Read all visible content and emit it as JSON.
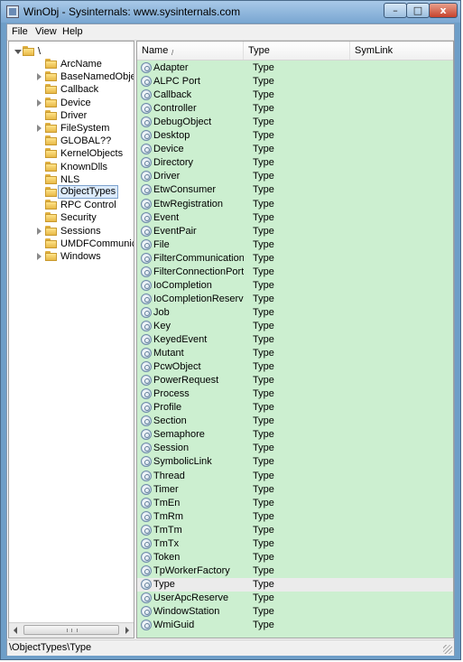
{
  "window": {
    "title": "WinObj - Sysinternals: www.sysinternals.com",
    "controls": {
      "minimize": "–",
      "maximize": "□",
      "close": "x"
    }
  },
  "menu": [
    "File",
    "View",
    "Help"
  ],
  "tree": {
    "root": "\\",
    "children": [
      {
        "label": "ArcName",
        "expandable": false
      },
      {
        "label": "BaseNamedObjects",
        "expandable": true
      },
      {
        "label": "Callback",
        "expandable": false
      },
      {
        "label": "Device",
        "expandable": true
      },
      {
        "label": "Driver",
        "expandable": false
      },
      {
        "label": "FileSystem",
        "expandable": true
      },
      {
        "label": "GLOBAL??",
        "expandable": false
      },
      {
        "label": "KernelObjects",
        "expandable": false
      },
      {
        "label": "KnownDlls",
        "expandable": false
      },
      {
        "label": "NLS",
        "expandable": false
      },
      {
        "label": "ObjectTypes",
        "expandable": false,
        "selected": true
      },
      {
        "label": "RPC Control",
        "expandable": false
      },
      {
        "label": "Security",
        "expandable": false
      },
      {
        "label": "Sessions",
        "expandable": true
      },
      {
        "label": "UMDFCommunicationPorts",
        "expandable": false
      },
      {
        "label": "Windows",
        "expandable": true
      }
    ]
  },
  "list": {
    "columns": [
      "Name",
      "Type",
      "SymLink"
    ],
    "sort_indicator": "/",
    "rows": [
      {
        "name": "Adapter",
        "type": "Type"
      },
      {
        "name": "ALPC Port",
        "type": "Type"
      },
      {
        "name": "Callback",
        "type": "Type"
      },
      {
        "name": "Controller",
        "type": "Type"
      },
      {
        "name": "DebugObject",
        "type": "Type"
      },
      {
        "name": "Desktop",
        "type": "Type"
      },
      {
        "name": "Device",
        "type": "Type"
      },
      {
        "name": "Directory",
        "type": "Type"
      },
      {
        "name": "Driver",
        "type": "Type"
      },
      {
        "name": "EtwConsumer",
        "type": "Type"
      },
      {
        "name": "EtwRegistration",
        "type": "Type"
      },
      {
        "name": "Event",
        "type": "Type"
      },
      {
        "name": "EventPair",
        "type": "Type"
      },
      {
        "name": "File",
        "type": "Type"
      },
      {
        "name": "FilterCommunication...",
        "type": "Type"
      },
      {
        "name": "FilterConnectionPort",
        "type": "Type"
      },
      {
        "name": "IoCompletion",
        "type": "Type"
      },
      {
        "name": "IoCompletionReserve",
        "type": "Type"
      },
      {
        "name": "Job",
        "type": "Type"
      },
      {
        "name": "Key",
        "type": "Type"
      },
      {
        "name": "KeyedEvent",
        "type": "Type"
      },
      {
        "name": "Mutant",
        "type": "Type"
      },
      {
        "name": "PcwObject",
        "type": "Type"
      },
      {
        "name": "PowerRequest",
        "type": "Type"
      },
      {
        "name": "Process",
        "type": "Type"
      },
      {
        "name": "Profile",
        "type": "Type"
      },
      {
        "name": "Section",
        "type": "Type"
      },
      {
        "name": "Semaphore",
        "type": "Type"
      },
      {
        "name": "Session",
        "type": "Type"
      },
      {
        "name": "SymbolicLink",
        "type": "Type"
      },
      {
        "name": "Thread",
        "type": "Type"
      },
      {
        "name": "Timer",
        "type": "Type"
      },
      {
        "name": "TmEn",
        "type": "Type"
      },
      {
        "name": "TmRm",
        "type": "Type"
      },
      {
        "name": "TmTm",
        "type": "Type"
      },
      {
        "name": "TmTx",
        "type": "Type"
      },
      {
        "name": "Token",
        "type": "Type"
      },
      {
        "name": "TpWorkerFactory",
        "type": "Type"
      },
      {
        "name": "Type",
        "type": "Type",
        "selected": true
      },
      {
        "name": "UserApcReserve",
        "type": "Type"
      },
      {
        "name": "WindowStation",
        "type": "Type"
      },
      {
        "name": "WmiGuid",
        "type": "Type"
      }
    ]
  },
  "status": "\\ObjectTypes\\Type",
  "colors": {
    "list_background": "#ccefd0",
    "selected_row": "#ebebeb",
    "title_bar": "#7aa7d2"
  }
}
